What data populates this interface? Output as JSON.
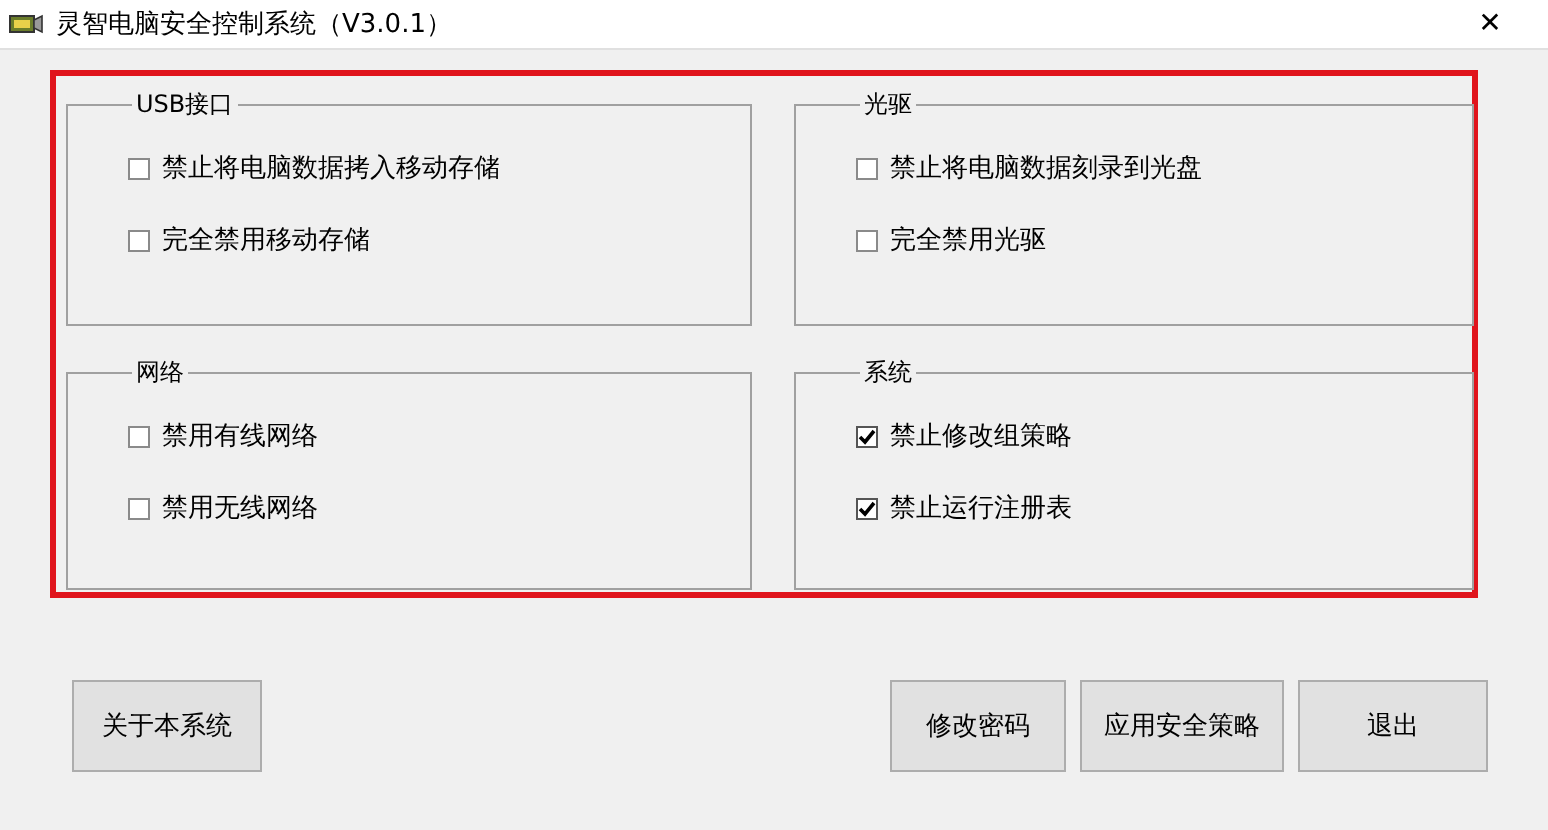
{
  "window": {
    "title": "灵智电脑安全控制系统（V3.0.1）",
    "close": "✕"
  },
  "groups": [
    {
      "title": "USB接口",
      "options": [
        {
          "label": "禁止将电脑数据拷入移动存储",
          "checked": false
        },
        {
          "label": "完全禁用移动存储",
          "checked": false
        }
      ]
    },
    {
      "title": "光驱",
      "options": [
        {
          "label": "禁止将电脑数据刻录到光盘",
          "checked": false
        },
        {
          "label": "完全禁用光驱",
          "checked": false
        }
      ]
    },
    {
      "title": "网络",
      "options": [
        {
          "label": "禁用有线网络",
          "checked": false
        },
        {
          "label": "禁用无线网络",
          "checked": false
        }
      ]
    },
    {
      "title": "系统",
      "options": [
        {
          "label": "禁止修改组策略",
          "checked": true
        },
        {
          "label": "禁止运行注册表",
          "checked": true
        }
      ]
    }
  ],
  "buttons_left": [
    "关于本系统"
  ],
  "buttons_right": [
    "修改密码",
    "应用安全策略",
    "退出"
  ]
}
